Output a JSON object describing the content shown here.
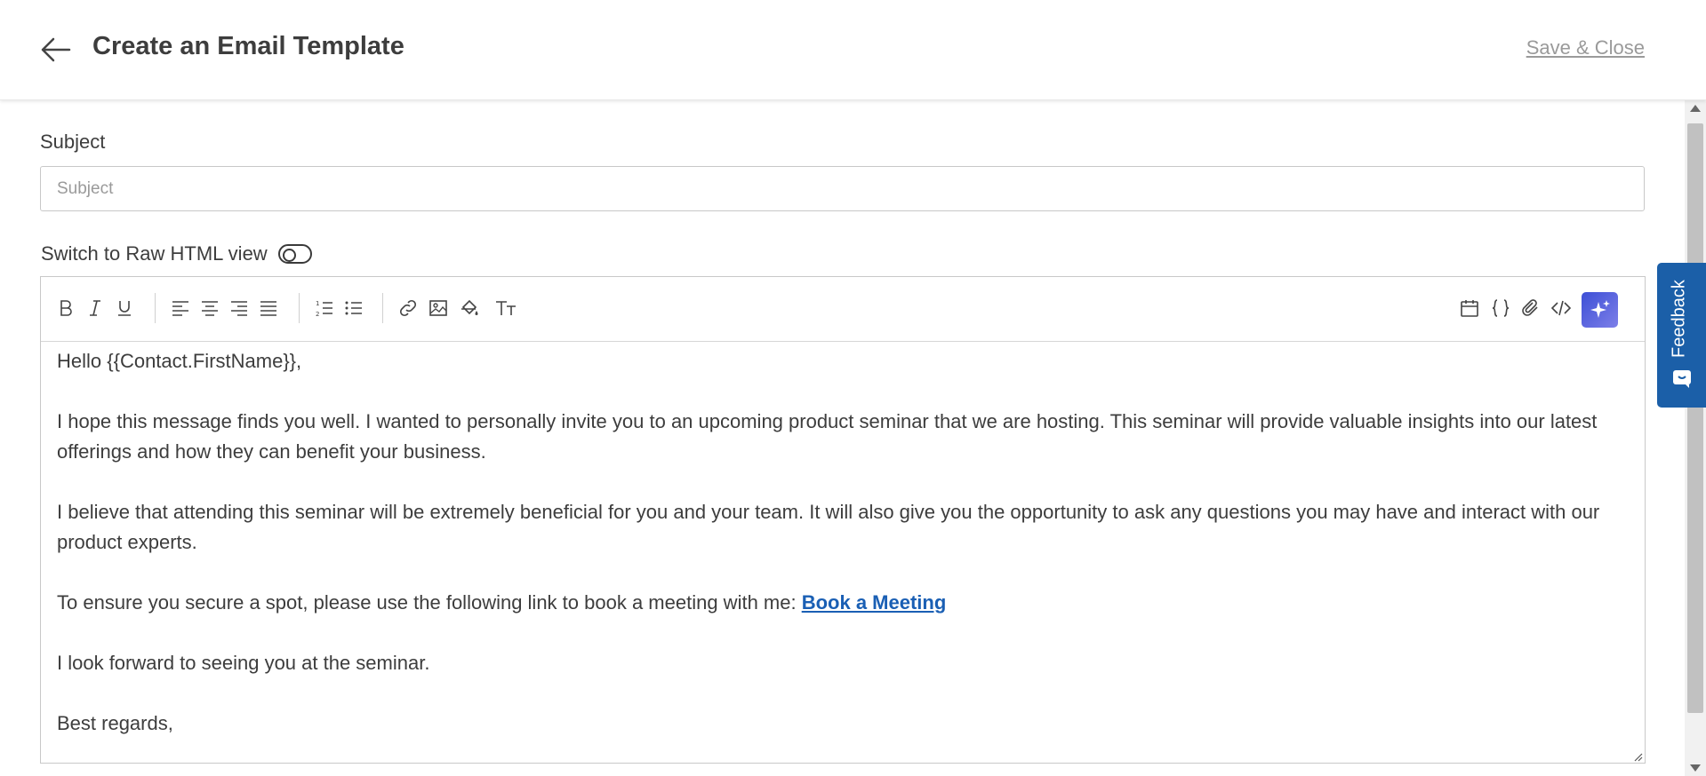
{
  "header": {
    "title": "Create an Email Template",
    "save_close_label": "Save & Close"
  },
  "form": {
    "subject_label": "Subject",
    "subject_placeholder": "Subject",
    "subject_value": "",
    "raw_html_label": "Switch to Raw HTML view",
    "raw_html_enabled": false
  },
  "toolbar": {
    "left_groups": [
      [
        "bold-icon",
        "italic-icon",
        "underline-icon"
      ],
      [
        "align-left-icon",
        "align-center-icon",
        "align-right-icon",
        "align-justify-icon"
      ],
      [
        "ordered-list-icon",
        "unordered-list-icon"
      ],
      [
        "link-icon",
        "image-icon",
        "fill-color-icon",
        "text-size-icon"
      ]
    ],
    "right_icons": [
      "calendar-icon",
      "braces-icon",
      "attachment-icon",
      "code-icon",
      "ai-sparkle-icon"
    ]
  },
  "email_body": {
    "greeting": "Hello {{Contact.FirstName}},",
    "paragraph1": "I hope this message finds you well. I wanted to personally invite you to an upcoming product seminar that we are hosting. This seminar will provide valuable insights into our latest offerings and how they can benefit your business.",
    "paragraph2": "I believe that attending this seminar will be extremely beneficial for you and your team. It will also give you the opportunity to ask any questions you may have and interact with our product experts.",
    "paragraph3_prefix": "To ensure you secure a spot, please use the following link to book a meeting with me: ",
    "meeting_link_text": "Book a Meeting",
    "paragraph4": "I look forward to seeing you at the seminar.",
    "closing": "Best regards,"
  },
  "feedback": {
    "label": "Feedback"
  },
  "colors": {
    "accent_blue": "#1b5fa8",
    "link_blue": "#1a5fb4",
    "ai_gradient_start": "#3d4fd6",
    "ai_gradient_end": "#7d7fe8"
  }
}
